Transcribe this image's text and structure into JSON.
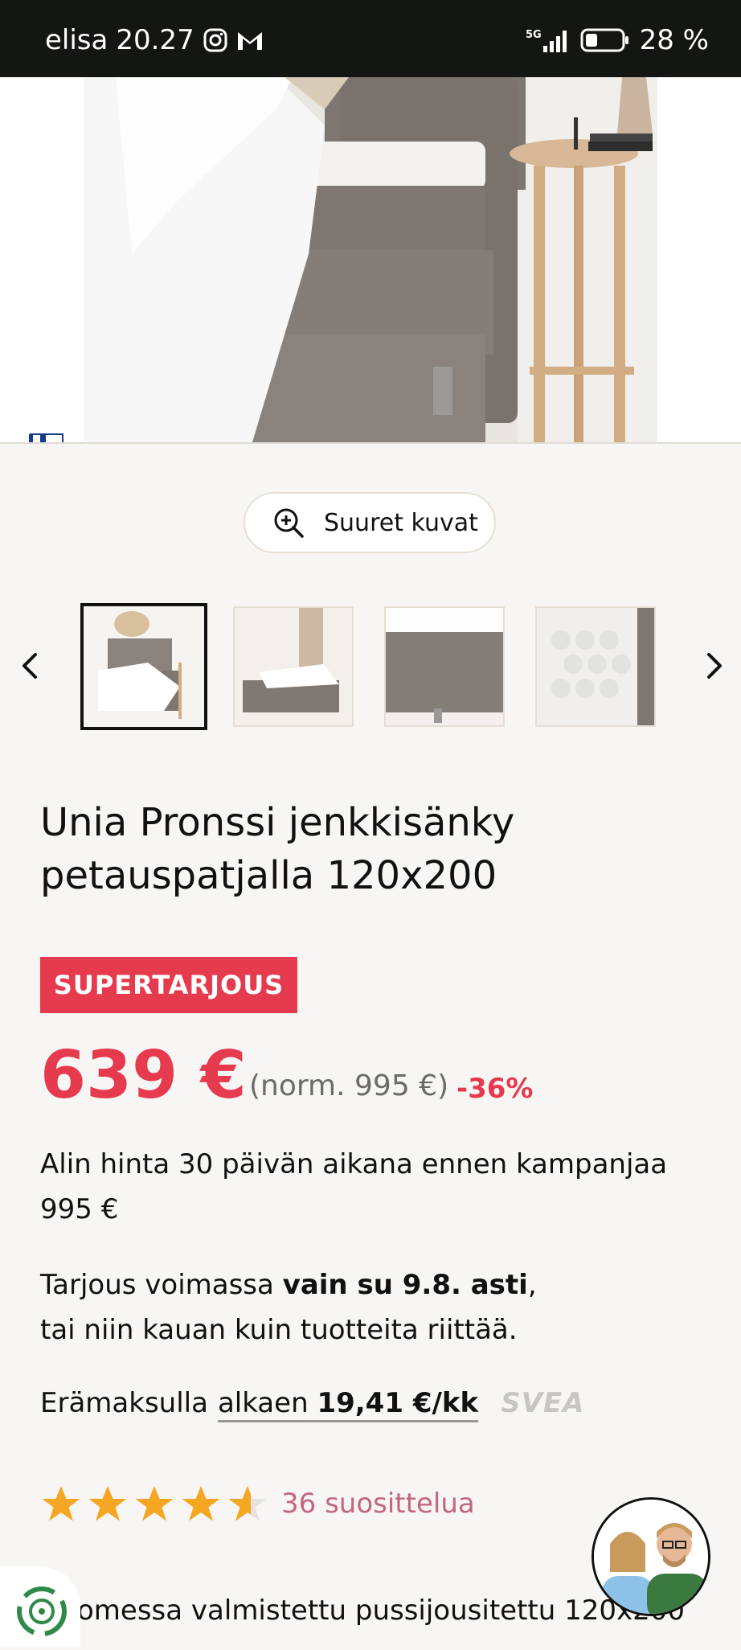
{
  "status_bar": {
    "carrier": "elisa",
    "time": "20.27",
    "network": "5G",
    "battery": "28 %"
  },
  "gallery": {
    "zoom_label": "Suuret kuvat",
    "thumbnails": [
      "thumb-1",
      "thumb-2",
      "thumb-3",
      "thumb-4"
    ]
  },
  "product": {
    "title": "Unia Pronssi jenkkisänky petauspatjalla 120x200",
    "badge": "SUPERTARJOUS",
    "price": "639 €",
    "norm_price": "(norm. 995 €)",
    "discount": "-36%",
    "lowest_price_note": "Alin hinta 30 päivän aikana ennen kampanjaa 995 €",
    "offer_prefix": "Tarjous voimassa ",
    "offer_bold": "vain su 9.8. asti",
    "offer_suffix": ",",
    "offer_line2": "tai niin kauan kuin tuotteita riittää.",
    "installment_prefix": "Erämaksulla",
    "installment_link_text": "alkaen",
    "installment_amount": "19,41 €/kk",
    "installment_provider": "SVEA",
    "rating": 4.5,
    "reviews": "36 suosittelua",
    "description_partial": "omessa valmistettu pussijousitettu 120x200"
  },
  "colors": {
    "accent": "#e63a4f",
    "status_bar": "#141613",
    "review_link": "#c2677e",
    "star": "#f5a623"
  }
}
